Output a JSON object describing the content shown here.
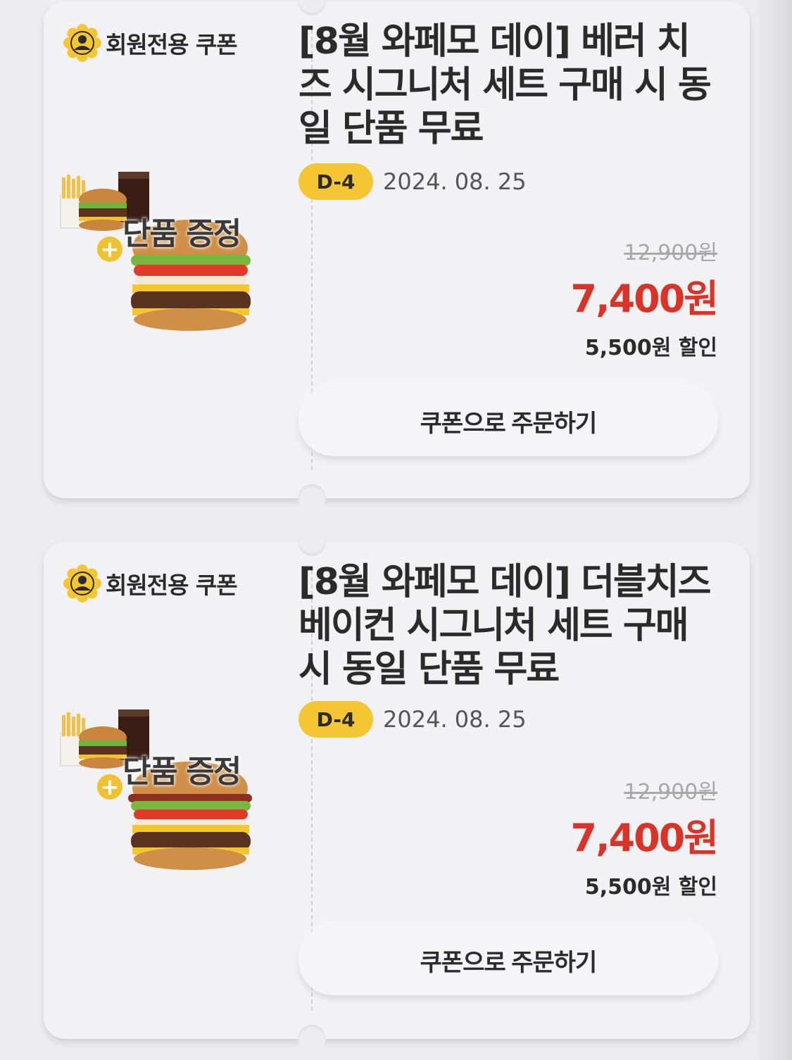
{
  "coupons": [
    {
      "badge": "회원전용 쿠폰",
      "gift_text": "단품 증정",
      "title": "[8월 와페모 데이] 베러 치즈 시그니처 세트 구매 시 동일 단품 무료",
      "dday": "D-4",
      "date": "2024. 08. 25",
      "original_price": "12,900원",
      "sale_price": "7,400원",
      "discount": "5,500원 할인",
      "button": "쿠폰으로 주문하기"
    },
    {
      "badge": "회원전용 쿠폰",
      "gift_text": "단품 증정",
      "title": "[8월 와페모 데이] 더블치즈 베이컨 시그니처 세트 구매 시 동일 단품 무료",
      "dday": "D-4",
      "date": "2024. 08. 25",
      "original_price": "12,900원",
      "sale_price": "7,400원",
      "discount": "5,500원 할인",
      "button": "쿠폰으로 주문하기"
    }
  ],
  "colors": {
    "accent_yellow": "#f5c634",
    "sale_red": "#d8342a",
    "card_bg": "#f2f2f5"
  }
}
